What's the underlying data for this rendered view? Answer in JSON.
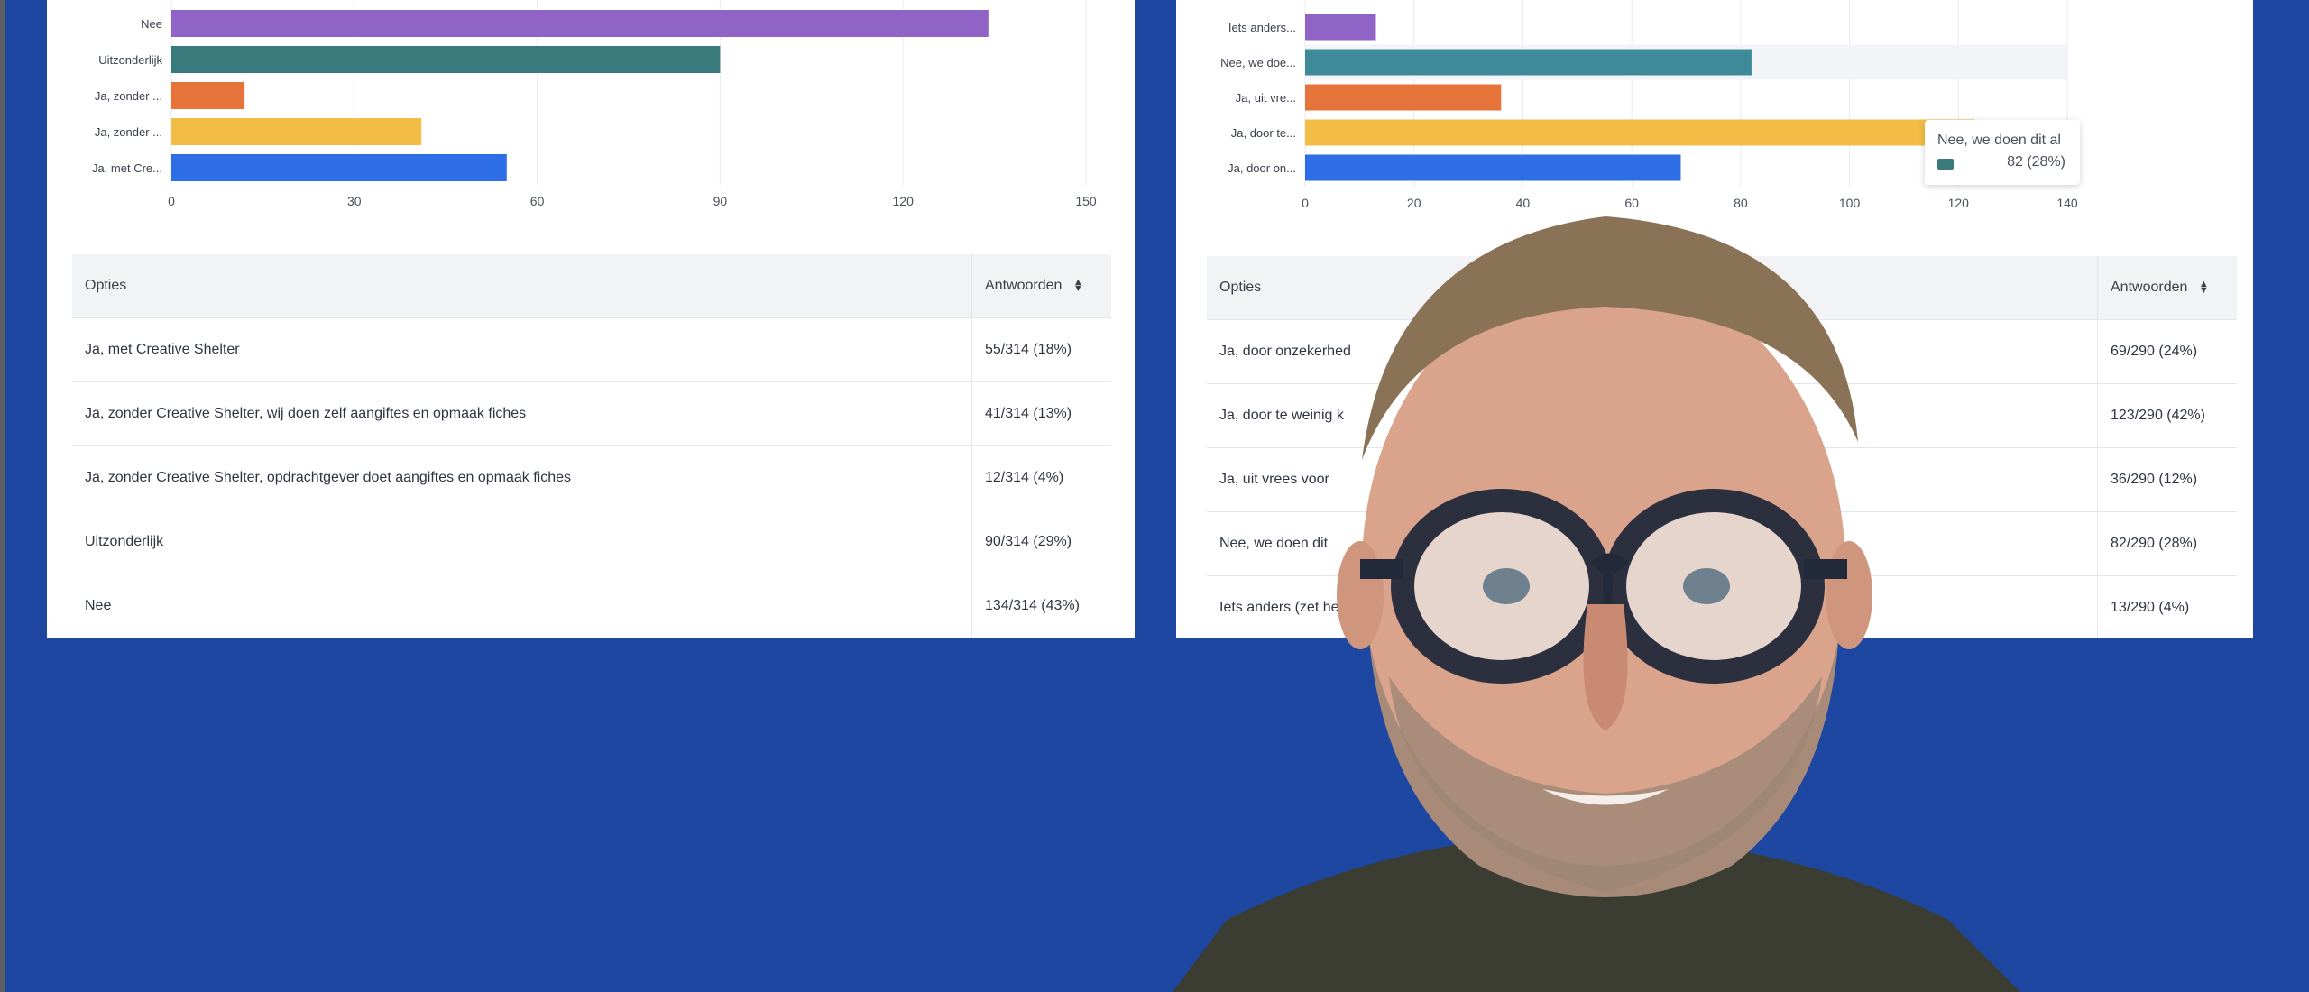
{
  "left_panel": {
    "chart_data": {
      "type": "bar",
      "orientation": "horizontal",
      "categories": [
        "Nee",
        "Uitzonderlijk",
        "Ja, zonder ...",
        "Ja, zonder ...",
        "Ja, met Cre..."
      ],
      "values": [
        134,
        90,
        12,
        41,
        55
      ],
      "colors": [
        "#9063c6",
        "#3a7a7c",
        "#e6743a",
        "#f3bc45",
        "#2d6ee6"
      ],
      "xticks": [
        "0",
        "30",
        "60",
        "90",
        "120",
        "150"
      ],
      "xlim": [
        0,
        150
      ],
      "grid": true
    },
    "table": {
      "col_options": "Opties",
      "col_answers": "Antwoorden",
      "rows": [
        {
          "option": "Ja, met Creative Shelter",
          "answers": "55/314 (18%)"
        },
        {
          "option": "Ja, zonder Creative Shelter, wij doen zelf aangiftes en opmaak fiches",
          "answers": "41/314 (13%)"
        },
        {
          "option": "Ja, zonder Creative Shelter, opdrachtgever doet aangiftes en opmaak fiches",
          "answers": "12/314 (4%)"
        },
        {
          "option": "Uitzonderlijk",
          "answers": "90/314 (29%)"
        },
        {
          "option": "Nee",
          "answers": "134/314 (43%)"
        }
      ]
    }
  },
  "right_panel": {
    "chart_data": {
      "type": "bar",
      "orientation": "horizontal",
      "categories": [
        "Iets anders...",
        "Nee, we doe...",
        "Ja, uit vre...",
        "Ja, door te...",
        "Ja, door on..."
      ],
      "values": [
        13,
        82,
        36,
        123,
        69
      ],
      "colors": [
        "#9063c6",
        "#3f8a99",
        "#e6743a",
        "#f3bc45",
        "#2d6ee6"
      ],
      "xticks": [
        "0",
        "20",
        "40",
        "60",
        "80",
        "100",
        "120",
        "140"
      ],
      "xlim": [
        0,
        140
      ],
      "grid": true,
      "highlighted_category": "Nee, we doe..."
    },
    "tooltip": {
      "title": "Nee, we doen dit al",
      "value": "82 (28%)"
    },
    "table": {
      "col_options": "Opties",
      "col_answers": "Antwoorden",
      "rows": [
        {
          "option": "Ja, door onzekerhed",
          "answers": "69/290 (24%)"
        },
        {
          "option": "Ja, door te weinig k",
          "answers": "123/290 (42%)"
        },
        {
          "option": "Ja, uit vrees voor",
          "answers": "36/290 (12%)"
        },
        {
          "option": "Nee, we doen dit",
          "answers": "82/290 (28%)"
        },
        {
          "option": "Iets anders (zet he",
          "answers": "13/290 (4%)"
        }
      ]
    }
  },
  "colors": {
    "background": "#1d47a0",
    "panel": "#ffffff"
  }
}
